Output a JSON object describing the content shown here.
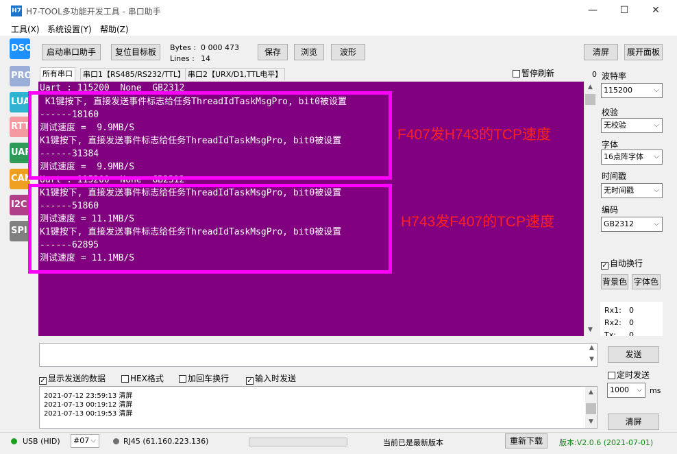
{
  "window": {
    "icon_text": "H7",
    "title": "H7-TOOL多功能开发工具 - 串口助手",
    "minimize": "—",
    "maximize": "☐",
    "close": "✕"
  },
  "menu": [
    "工具(X)",
    "系统设置(Y)",
    "帮助(Z)"
  ],
  "side_tabs": [
    {
      "label": "DSO",
      "color": "#1e90ff"
    },
    {
      "label": "PROG",
      "color": "#9aaed8"
    },
    {
      "label": "LUA",
      "color": "#2fb3d0"
    },
    {
      "label": "RTT",
      "color": "#f59aa0"
    },
    {
      "label": "UART",
      "color": "#2e9a58"
    },
    {
      "label": "CAN",
      "color": "#f0a020"
    },
    {
      "label": "I2C",
      "color": "#b0408a"
    },
    {
      "label": "SPI",
      "color": "#808080"
    }
  ],
  "toolbar": {
    "start_btn": "启动串口助手",
    "reset_btn": "复位目标板",
    "bytes_label": "Bytes :",
    "bytes_value": "0 000 473",
    "lines_label": "Lines :",
    "lines_value": "14",
    "save_btn": "保存",
    "browse_btn": "浏览",
    "wave_btn": "波形",
    "clear_btn": "清屏",
    "expand_btn": "展开面板"
  },
  "tabs": [
    "所有串口",
    "串口1【RS485/RS232/TTL】",
    "串口2【URX/D1,TTL电平】"
  ],
  "pause_refresh": "暂停刷新",
  "pause_count": "0",
  "terminal_lines": [
    "Uart : 115200  None  GB2312",
    " K1键按下, 直接发送事件标志给任务ThreadIdTaskMsgPro, bit0被设置",
    "------18160",
    "测试速度 =  9.9MB/S",
    "K1键按下, 直接发送事件标志给任务ThreadIdTaskMsgPro, bit0被设置",
    "------31384",
    "测试速度 =  9.9MB/S",
    "Uart : 115200  None  GB2312",
    "K1键按下, 直接发送事件标志给任务ThreadIdTaskMsgPro, bit0被设置",
    "------51860",
    "测试速度 = 11.1MB/S",
    "K1键按下, 直接发送事件标志给任务ThreadIdTaskMsgPro, bit0被设置",
    "------62895",
    "测试速度 = 11.1MB/S"
  ],
  "annotations": {
    "top": "F407发H743的TCP速度",
    "bottom": "H743发F407的TCP速度"
  },
  "right_panel": {
    "baud_label": "波特率",
    "baud_value": "115200",
    "parity_label": "校验",
    "parity_value": "无校验",
    "font_label": "字体",
    "font_value": "16点阵字体",
    "timestamp_label": "时间戳",
    "timestamp_value": "无时间戳",
    "encoding_label": "编码",
    "encoding_value": "GB2312",
    "auto_wrap": "自动换行",
    "bg_color_btn": "背景色",
    "font_color_btn": "字体色",
    "rx1_label": "Rx1:",
    "rx1_value": "0",
    "rx2_label": "Rx2:",
    "rx2_value": "0",
    "tx_label": "Tx:",
    "tx_value": "0"
  },
  "send_area": {
    "send_btn": "发送",
    "show_sent": "显示发送的数据",
    "hex_format": "HEX格式",
    "add_crlf": "加回车换行",
    "send_on_input": "输入时发送",
    "timed_send": "定时发送",
    "interval_value": "1000",
    "interval_unit": "ms",
    "clear_log_btn": "清屏"
  },
  "log_lines": [
    "2021-07-12 23:59:13 清屏",
    "2021-07-13 00:19:12 清屏",
    "2021-07-13 00:19:53 清屏"
  ],
  "status_bar": {
    "usb": "USB (HID)",
    "device_select": "#07",
    "rj45": "RJ45 (61.160.223.136)",
    "version_status": "当前已是最新版本",
    "redownload_btn": "重新下载",
    "version": "版本:V2.0.6 (2021-07-01)",
    "usb_color": "#1aa01a",
    "rj45_color": "#707070"
  }
}
